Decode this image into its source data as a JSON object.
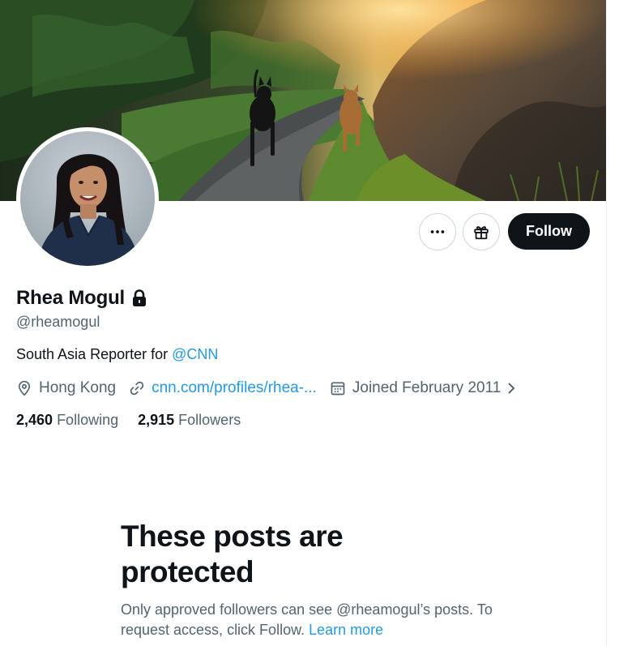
{
  "profile": {
    "display_name": "Rhea Mogul",
    "handle": "@rheamogul",
    "bio_prefix": "South Asia Reporter for ",
    "bio_mention": "@CNN",
    "location": "Hong Kong",
    "website": "cnn.com/profiles/rhea-...",
    "joined": "Joined February 2011"
  },
  "actions": {
    "follow_label": "Follow"
  },
  "stats": {
    "following_count": "2,460",
    "following_label": "Following",
    "followers_count": "2,915",
    "followers_label": "Followers"
  },
  "protected": {
    "title": "These posts are protected",
    "text": "Only approved followers can see @rheamogul’s posts. To request access, click Follow.",
    "learn_more": "Learn more"
  },
  "colors": {
    "accent": "#1d9bf0",
    "text_primary": "#0f1419",
    "text_secondary": "#536471",
    "follow_button_bg": "#0f1419"
  },
  "icons": [
    "more-icon",
    "gift-icon",
    "lock-icon",
    "location-icon",
    "link-icon",
    "calendar-icon",
    "chevron-right-icon"
  ]
}
